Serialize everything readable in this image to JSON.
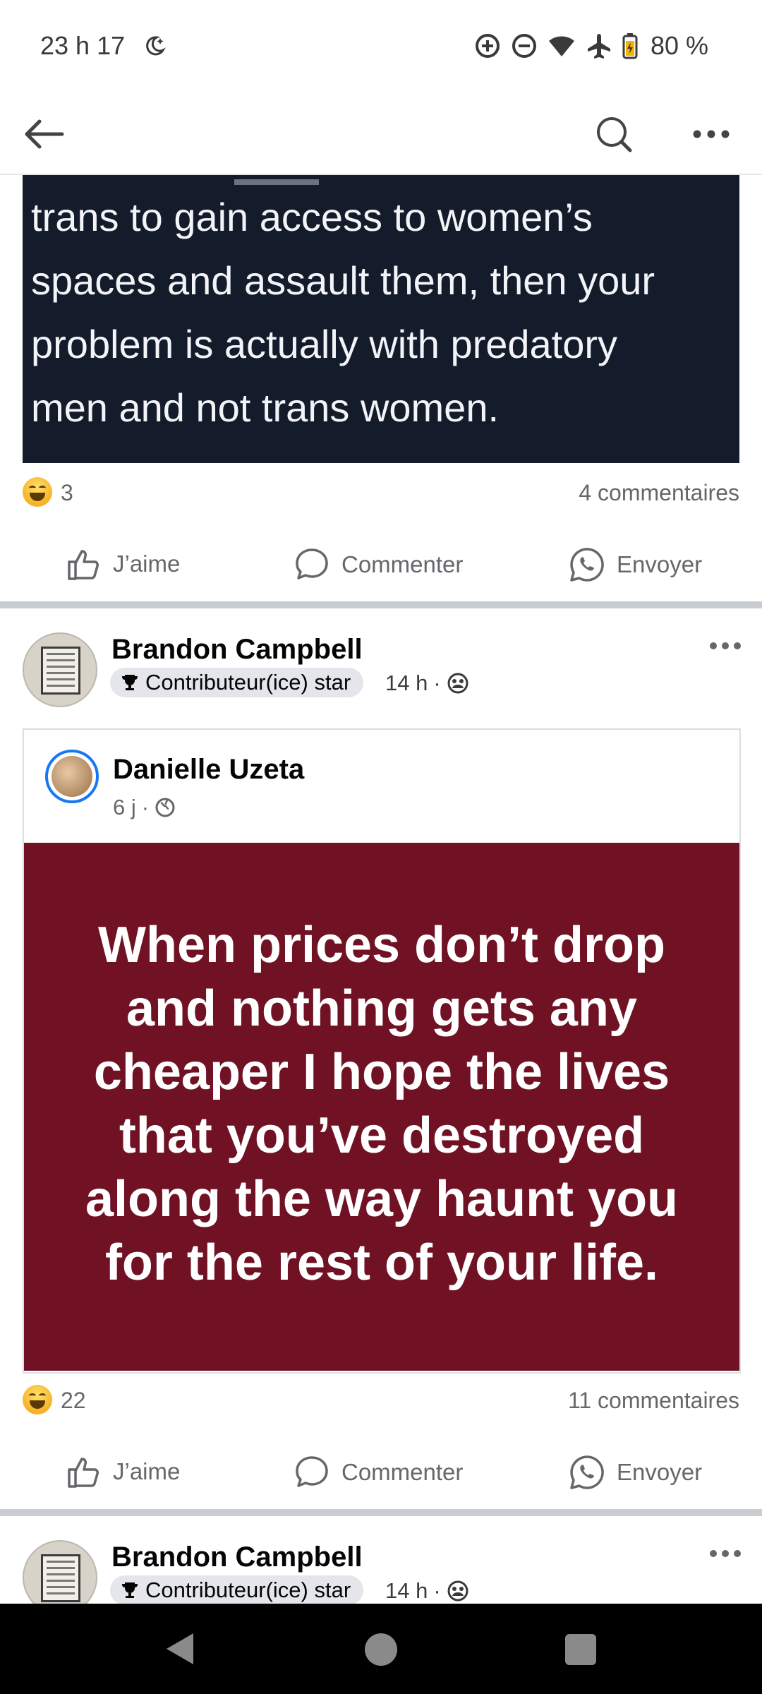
{
  "status_bar": {
    "time": "23 h 17",
    "battery": "80 %",
    "icons": [
      "moon-icon",
      "data-saver-icon",
      "dnd-icon",
      "wifi-icon",
      "airplane-icon",
      "battery-icon"
    ]
  },
  "nav": {
    "icons": [
      "back-arrow-icon",
      "search-icon",
      "more-icon"
    ]
  },
  "post1": {
    "image_lines": [
      "trans to gain access to women’s",
      "spaces and assault them, then your",
      "problem is actually with predatory",
      "men and not trans women."
    ],
    "reactions_count": "3",
    "comments": "4 commentaires"
  },
  "actions": {
    "like": "J’aime",
    "comment": "Commenter",
    "send": "Envoyer"
  },
  "post2": {
    "author": "Brandon Campbell",
    "badge": "Contributeur(ice) star",
    "time": "14 h",
    "shared": {
      "author": "Danielle Uzeta",
      "time": "6 j",
      "quote": "When prices don’t drop and nothing gets any cheaper I hope the lives that you’ve destroyed along the way haunt you for the rest of your life."
    },
    "reactions_count": "22",
    "comments": "11 commentaires"
  },
  "post3": {
    "author": "Brandon Campbell",
    "badge": "Contributeur(ice) star",
    "time": "14 h"
  },
  "colors": {
    "quote_background": "#701224",
    "tweet_background": "#141c2b",
    "accent": "#1877f2"
  }
}
